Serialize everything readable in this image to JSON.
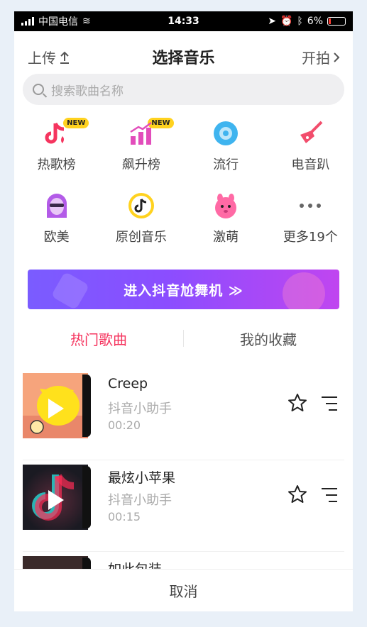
{
  "status": {
    "carrier": "中国电信",
    "time": "14:33",
    "battery": "6%"
  },
  "header": {
    "upload_label": "上传",
    "title": "选择音乐",
    "shoot_label": "开拍"
  },
  "search": {
    "placeholder": "搜索歌曲名称"
  },
  "categories": [
    {
      "label": "热歌榜",
      "badge": "NEW",
      "icon": "tiktok-music-icon",
      "color": "#f5355f"
    },
    {
      "label": "飙升榜",
      "badge": "NEW",
      "icon": "rising-bars-icon",
      "color": "#e24dbb"
    },
    {
      "label": "流行",
      "icon": "disc-icon",
      "color": "#3fb4ef"
    },
    {
      "label": "电音趴",
      "icon": "guitar-icon",
      "color": "#f24d6c"
    },
    {
      "label": "欧美",
      "icon": "avatar-icon",
      "color": "#b35be8"
    },
    {
      "label": "原创音乐",
      "icon": "music-note-circle-icon",
      "color": "#ffd21f"
    },
    {
      "label": "激萌",
      "icon": "cute-face-icon",
      "color": "#ff6aa5"
    },
    {
      "label": "更多19个",
      "icon": "more-dots-icon",
      "color": "#777777"
    }
  ],
  "banner": {
    "label": "进入抖音尬舞机 ≫"
  },
  "tabs": [
    {
      "label": "热门歌曲",
      "active": true
    },
    {
      "label": "我的收藏",
      "active": false
    }
  ],
  "songs": [
    {
      "title": "Creep",
      "artist": "抖音小助手",
      "duration": "00:20"
    },
    {
      "title": "最炫小苹果",
      "artist": "抖音小助手",
      "duration": "00:15"
    },
    {
      "title": "如此包装",
      "artist": "",
      "duration": ""
    }
  ],
  "footer": {
    "cancel_label": "取消"
  }
}
